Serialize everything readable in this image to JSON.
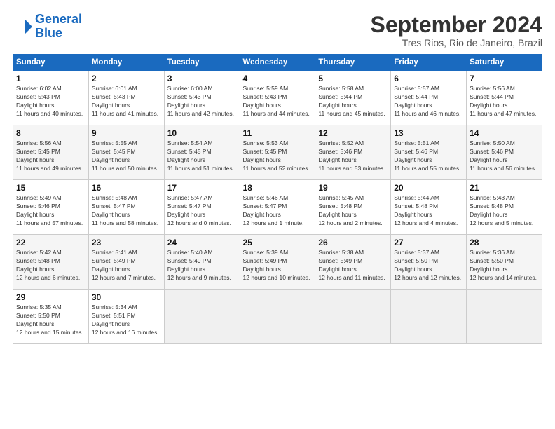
{
  "logo": {
    "line1": "General",
    "line2": "Blue"
  },
  "title": "September 2024",
  "location": "Tres Rios, Rio de Janeiro, Brazil",
  "headers": [
    "Sunday",
    "Monday",
    "Tuesday",
    "Wednesday",
    "Thursday",
    "Friday",
    "Saturday"
  ],
  "weeks": [
    [
      {
        "day": "1",
        "sunrise": "Sunrise: 6:02 AM",
        "sunset": "Sunset: 5:43 PM",
        "daylight": "Daylight: 11 hours and 40 minutes."
      },
      {
        "day": "2",
        "sunrise": "Sunrise: 6:01 AM",
        "sunset": "Sunset: 5:43 PM",
        "daylight": "Daylight: 11 hours and 41 minutes."
      },
      {
        "day": "3",
        "sunrise": "Sunrise: 6:00 AM",
        "sunset": "Sunset: 5:43 PM",
        "daylight": "Daylight: 11 hours and 42 minutes."
      },
      {
        "day": "4",
        "sunrise": "Sunrise: 5:59 AM",
        "sunset": "Sunset: 5:43 PM",
        "daylight": "Daylight: 11 hours and 44 minutes."
      },
      {
        "day": "5",
        "sunrise": "Sunrise: 5:58 AM",
        "sunset": "Sunset: 5:44 PM",
        "daylight": "Daylight: 11 hours and 45 minutes."
      },
      {
        "day": "6",
        "sunrise": "Sunrise: 5:57 AM",
        "sunset": "Sunset: 5:44 PM",
        "daylight": "Daylight: 11 hours and 46 minutes."
      },
      {
        "day": "7",
        "sunrise": "Sunrise: 5:56 AM",
        "sunset": "Sunset: 5:44 PM",
        "daylight": "Daylight: 11 hours and 47 minutes."
      }
    ],
    [
      {
        "day": "8",
        "sunrise": "Sunrise: 5:56 AM",
        "sunset": "Sunset: 5:45 PM",
        "daylight": "Daylight: 11 hours and 49 minutes."
      },
      {
        "day": "9",
        "sunrise": "Sunrise: 5:55 AM",
        "sunset": "Sunset: 5:45 PM",
        "daylight": "Daylight: 11 hours and 50 minutes."
      },
      {
        "day": "10",
        "sunrise": "Sunrise: 5:54 AM",
        "sunset": "Sunset: 5:45 PM",
        "daylight": "Daylight: 11 hours and 51 minutes."
      },
      {
        "day": "11",
        "sunrise": "Sunrise: 5:53 AM",
        "sunset": "Sunset: 5:45 PM",
        "daylight": "Daylight: 11 hours and 52 minutes."
      },
      {
        "day": "12",
        "sunrise": "Sunrise: 5:52 AM",
        "sunset": "Sunset: 5:46 PM",
        "daylight": "Daylight: 11 hours and 53 minutes."
      },
      {
        "day": "13",
        "sunrise": "Sunrise: 5:51 AM",
        "sunset": "Sunset: 5:46 PM",
        "daylight": "Daylight: 11 hours and 55 minutes."
      },
      {
        "day": "14",
        "sunrise": "Sunrise: 5:50 AM",
        "sunset": "Sunset: 5:46 PM",
        "daylight": "Daylight: 11 hours and 56 minutes."
      }
    ],
    [
      {
        "day": "15",
        "sunrise": "Sunrise: 5:49 AM",
        "sunset": "Sunset: 5:46 PM",
        "daylight": "Daylight: 11 hours and 57 minutes."
      },
      {
        "day": "16",
        "sunrise": "Sunrise: 5:48 AM",
        "sunset": "Sunset: 5:47 PM",
        "daylight": "Daylight: 11 hours and 58 minutes."
      },
      {
        "day": "17",
        "sunrise": "Sunrise: 5:47 AM",
        "sunset": "Sunset: 5:47 PM",
        "daylight": "Daylight: 12 hours and 0 minutes."
      },
      {
        "day": "18",
        "sunrise": "Sunrise: 5:46 AM",
        "sunset": "Sunset: 5:47 PM",
        "daylight": "Daylight: 12 hours and 1 minute."
      },
      {
        "day": "19",
        "sunrise": "Sunrise: 5:45 AM",
        "sunset": "Sunset: 5:48 PM",
        "daylight": "Daylight: 12 hours and 2 minutes."
      },
      {
        "day": "20",
        "sunrise": "Sunrise: 5:44 AM",
        "sunset": "Sunset: 5:48 PM",
        "daylight": "Daylight: 12 hours and 4 minutes."
      },
      {
        "day": "21",
        "sunrise": "Sunrise: 5:43 AM",
        "sunset": "Sunset: 5:48 PM",
        "daylight": "Daylight: 12 hours and 5 minutes."
      }
    ],
    [
      {
        "day": "22",
        "sunrise": "Sunrise: 5:42 AM",
        "sunset": "Sunset: 5:48 PM",
        "daylight": "Daylight: 12 hours and 6 minutes."
      },
      {
        "day": "23",
        "sunrise": "Sunrise: 5:41 AM",
        "sunset": "Sunset: 5:49 PM",
        "daylight": "Daylight: 12 hours and 7 minutes."
      },
      {
        "day": "24",
        "sunrise": "Sunrise: 5:40 AM",
        "sunset": "Sunset: 5:49 PM",
        "daylight": "Daylight: 12 hours and 9 minutes."
      },
      {
        "day": "25",
        "sunrise": "Sunrise: 5:39 AM",
        "sunset": "Sunset: 5:49 PM",
        "daylight": "Daylight: 12 hours and 10 minutes."
      },
      {
        "day": "26",
        "sunrise": "Sunrise: 5:38 AM",
        "sunset": "Sunset: 5:49 PM",
        "daylight": "Daylight: 12 hours and 11 minutes."
      },
      {
        "day": "27",
        "sunrise": "Sunrise: 5:37 AM",
        "sunset": "Sunset: 5:50 PM",
        "daylight": "Daylight: 12 hours and 12 minutes."
      },
      {
        "day": "28",
        "sunrise": "Sunrise: 5:36 AM",
        "sunset": "Sunset: 5:50 PM",
        "daylight": "Daylight: 12 hours and 14 minutes."
      }
    ],
    [
      {
        "day": "29",
        "sunrise": "Sunrise: 5:35 AM",
        "sunset": "Sunset: 5:50 PM",
        "daylight": "Daylight: 12 hours and 15 minutes."
      },
      {
        "day": "30",
        "sunrise": "Sunrise: 5:34 AM",
        "sunset": "Sunset: 5:51 PM",
        "daylight": "Daylight: 12 hours and 16 minutes."
      },
      null,
      null,
      null,
      null,
      null
    ]
  ]
}
